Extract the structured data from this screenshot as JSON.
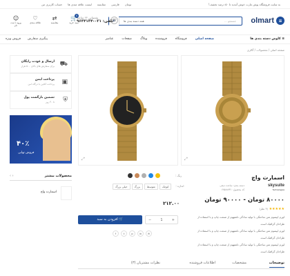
{
  "topbar": {
    "promo": "به سایت فروشگاه پوش مارت خوش آمدید تا ۵۰ درصد تخفیف!",
    "links": [
      "تومان",
      "فارسی",
      "مقایسه",
      "لیست علاقه مندی ها",
      "حساب کاربری من"
    ]
  },
  "header": {
    "logo_text": "olmart",
    "search_placeholder": "جستجو ...",
    "search_category": "همه دسته بندی ها",
    "phone_label": "پشتیبانی ۲۴ ساعته",
    "phone_number": "تلفن: ۰۲۱-۹۶۳۴۱۳۴",
    "icons": [
      {
        "label": "ورود / ثبت نام",
        "icon": "user-icon"
      },
      {
        "label": "علاقه مندی",
        "icon": "heart-icon"
      },
      {
        "label": "مقایسه",
        "icon": "compare-icon"
      },
      {
        "label": "سبد خرید",
        "icon": "cart-icon",
        "badge": "0"
      }
    ]
  },
  "nav": {
    "all_categories": "کاوش دسته بندی ها",
    "items": [
      "صفحه اصلی",
      "فروشگاه",
      "فروشنده",
      "وبلاگ",
      "صفحات",
      "عناصر"
    ],
    "left": [
      "پیگیری سفارش",
      "فروش ویژه"
    ]
  },
  "breadcrumb": "صفحه اصلی / محصولات / گالری",
  "features": [
    {
      "title": "ارسال و عودت رایگان",
      "sub": "برای سفارش های بالای ۵۰۰ هزار",
      "icon": "truck-icon"
    },
    {
      "title": "پرداخت ایمن",
      "sub": "پرداخت آنلاین با درگاه امن",
      "icon": "wallet-icon"
    },
    {
      "title": "تضمین بازگشت پول",
      "sub": "تا ۳۰ روز",
      "icon": "shield-icon"
    }
  ],
  "banner": {
    "percent": "۴۰٪",
    "label": "فروش نهایی"
  },
  "related": {
    "title": "محصولات بیشتر",
    "items": [
      {
        "name": "اسمارت واچ"
      }
    ]
  },
  "product": {
    "title": "اسمارت واچ",
    "brand": "skysuite",
    "brand_sub": "Technologies",
    "meta": [
      "دسته بندی: ساعت دیجی",
      "کد محصول: ۱۲۵۸۸۷۳۱"
    ],
    "price": "۸۰۰۰۰ تومان - ۹۰۰۰۰ تومان",
    "rating": "★★★★★",
    "reviews": "(۳ نظر)",
    "desc_lines": [
      "لورم ایپسوم متن ساختگی با تولید سادگی نامفهوم از صنعت چاپ و با استفاده از",
      "طراحان گرافیک است.",
      "لورم ایپسوم متن ساختگی با تولید سادگی نامفهوم از صنعت چاپ و با استفاده از",
      "طراحان گرافیک است.",
      "لورم ایپسوم متن ساختگی با تولید سادگی نامفهوم از صنعت چاپ و با استفاده از",
      "طراحان گرافیک است."
    ],
    "color_label": "رنگ :",
    "colors": [
      "#f4c20d",
      "#1e88e5",
      "#b0b0b0",
      "#c98a5a",
      "#333333"
    ],
    "size_label": "اندازه :",
    "sizes": [
      "کوچک",
      "متوسط",
      "بزرگ",
      "خیلی بزرگ"
    ],
    "selected_price": "۲۱۲.۰۰",
    "add_to_cart": "افزودن به سبد",
    "qty": "1",
    "social": [
      "f",
      "t",
      "p",
      "in",
      "✉"
    ]
  },
  "tabs": [
    "توضیحات",
    "مشخصات",
    "اطلاعات فروشنده",
    "نظرات مشتریان (۳)"
  ]
}
